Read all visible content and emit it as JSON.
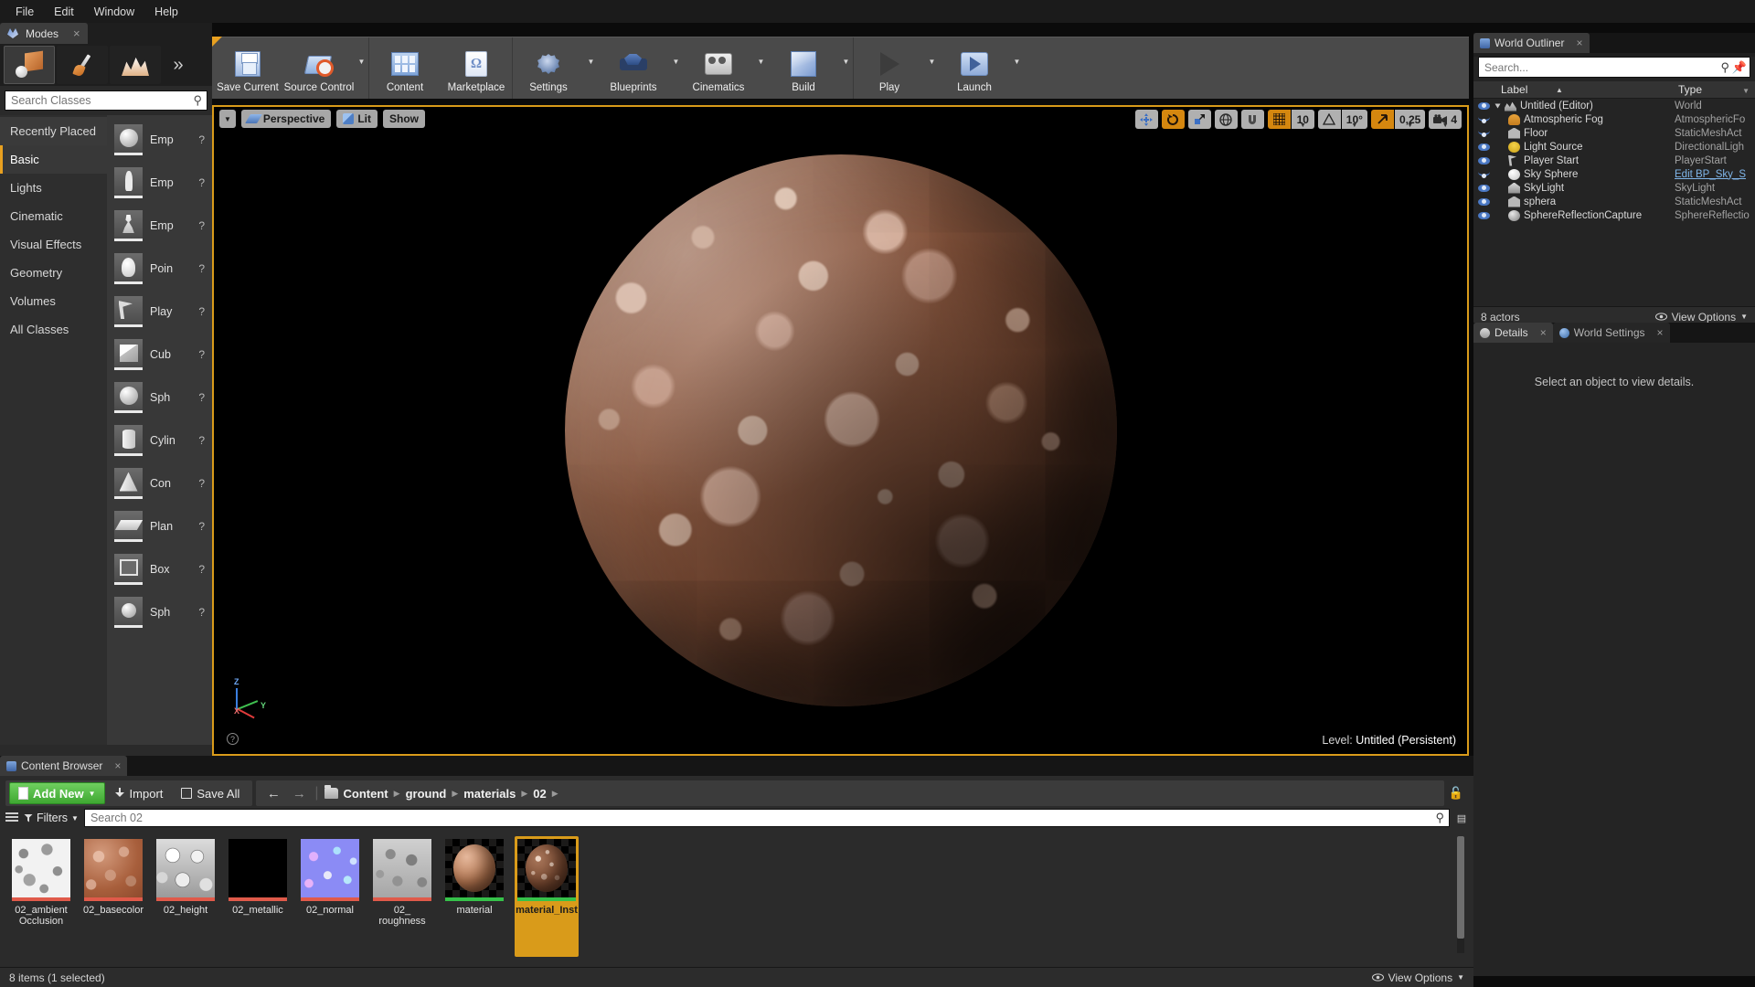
{
  "menu": {
    "items": [
      "File",
      "Edit",
      "Window",
      "Help"
    ]
  },
  "modes_panel": {
    "tab_label": "Modes",
    "tab_icon": "unreal-modes-icon",
    "mode_buttons": [
      {
        "name": "place-mode",
        "icon": "place-cube-icon",
        "active": true
      },
      {
        "name": "paint-mode",
        "icon": "paint-brush-icon",
        "active": false
      },
      {
        "name": "landscape-mode",
        "icon": "landscape-mountains-icon",
        "active": false
      },
      {
        "name": "expand-modes",
        "icon": "chevron-double-right-icon",
        "active": false
      }
    ],
    "search": {
      "placeholder": "Search Classes",
      "value": ""
    },
    "categories": [
      {
        "label": "Recently Placed",
        "selected": false,
        "hovered": true
      },
      {
        "label": "Basic",
        "selected": true,
        "hovered": false
      },
      {
        "label": "Lights",
        "selected": false,
        "hovered": false
      },
      {
        "label": "Cinematic",
        "selected": false,
        "hovered": false
      },
      {
        "label": "Visual Effects",
        "selected": false,
        "hovered": false
      },
      {
        "label": "Geometry",
        "selected": false,
        "hovered": false
      },
      {
        "label": "Volumes",
        "selected": false,
        "hovered": false
      },
      {
        "label": "All Classes",
        "selected": false,
        "hovered": false
      }
    ],
    "placeables": [
      {
        "label": "Emp",
        "thumb": "sphere-thumb",
        "help": "?"
      },
      {
        "label": "Emp",
        "thumb": "human-thumb",
        "help": "?"
      },
      {
        "label": "Emp",
        "thumb": "pawn-thumb",
        "help": "?"
      },
      {
        "label": "Poin",
        "thumb": "bulb-thumb",
        "help": "?"
      },
      {
        "label": "Play",
        "thumb": "flag-thumb",
        "help": "?"
      },
      {
        "label": "Cub",
        "thumb": "cube-thumb",
        "help": "?"
      },
      {
        "label": "Sph",
        "thumb": "sphere-thumb",
        "help": "?"
      },
      {
        "label": "Cylin",
        "thumb": "cylinder-thumb",
        "help": "?"
      },
      {
        "label": "Con",
        "thumb": "cone-thumb",
        "help": "?"
      },
      {
        "label": "Plan",
        "thumb": "plane-thumb",
        "help": "?"
      },
      {
        "label": "Box",
        "thumb": "box-thumb",
        "help": "?"
      },
      {
        "label": "Sph",
        "thumb": "sphere-thumb",
        "help": "?"
      }
    ]
  },
  "toolbar": {
    "groups": [
      {
        "items": [
          {
            "label": "Save Current",
            "icon": "save-icon",
            "dropdown": false
          },
          {
            "label": "Source Control",
            "icon": "source-control-icon",
            "dropdown": true
          }
        ]
      },
      {
        "items": [
          {
            "label": "Content",
            "icon": "content-icon",
            "dropdown": false
          },
          {
            "label": "Marketplace",
            "icon": "marketplace-icon",
            "dropdown": false
          }
        ]
      },
      {
        "items": [
          {
            "label": "Settings",
            "icon": "settings-gear-icon",
            "dropdown": true
          },
          {
            "label": "Blueprints",
            "icon": "blueprints-icon",
            "dropdown": true
          },
          {
            "label": "Cinematics",
            "icon": "cinematics-icon",
            "dropdown": true
          },
          {
            "label": "Build",
            "icon": "build-icon",
            "dropdown": true
          }
        ]
      },
      {
        "items": [
          {
            "label": "Play",
            "icon": "play-icon",
            "dropdown": true
          },
          {
            "label": "Launch",
            "icon": "launch-icon",
            "dropdown": true
          }
        ]
      }
    ]
  },
  "viewport": {
    "left_controls": [
      {
        "name": "viewport-options",
        "label": "",
        "icon": "chevron-down-icon"
      },
      {
        "name": "view-perspective",
        "label": "Perspective",
        "icon": "perspective-icon"
      },
      {
        "name": "view-mode-lit",
        "label": "Lit",
        "icon": "lit-cube-icon"
      },
      {
        "name": "show-menu",
        "label": "Show",
        "icon": ""
      }
    ],
    "transform_tools": [
      {
        "name": "translate-mode",
        "icon": "move-arrows-icon",
        "active": false
      },
      {
        "name": "rotate-mode",
        "icon": "rotate-icon",
        "active": true
      },
      {
        "name": "scale-mode",
        "icon": "scale-icon",
        "active": false
      }
    ],
    "coordinate_system": {
      "name": "world-space-toggle",
      "icon": "globe-icon"
    },
    "surface_snap": {
      "name": "surface-snap-toggle",
      "icon": "magnet-icon",
      "active": false
    },
    "grid_snap": {
      "name": "grid-snap-toggle",
      "icon": "grid-icon",
      "active": true,
      "value": "10"
    },
    "angle_snap": {
      "name": "angle-snap-toggle",
      "icon": "angle-icon",
      "active": false,
      "value": "10°"
    },
    "scale_snap": {
      "name": "scale-snap-toggle",
      "icon": "scale-arrow-icon",
      "active": true,
      "value": "0,25"
    },
    "camera_speed": {
      "name": "camera-speed",
      "icon": "camera-icon",
      "value": "4"
    },
    "level_label": "Level:",
    "level_name": "Untitled (Persistent)",
    "gizmo_axes": [
      "Z",
      "Y",
      "X"
    ]
  },
  "outliner": {
    "tab_label": "World Outliner",
    "search": {
      "placeholder": "Search...",
      "value": ""
    },
    "columns": {
      "label": "Label",
      "type": "Type"
    },
    "rows": [
      {
        "label": "Untitled (Editor)",
        "type": "World",
        "visible": true,
        "icon": "world-icon",
        "depth": 0,
        "expander": true
      },
      {
        "label": "Atmospheric Fog",
        "type": "AtmosphericFo",
        "visible": false,
        "icon": "fog-icon",
        "depth": 1
      },
      {
        "label": "Floor",
        "type": "StaticMeshAct",
        "visible": false,
        "icon": "mesh-icon",
        "depth": 1
      },
      {
        "label": "Light Source",
        "type": "DirectionalLigh",
        "visible": true,
        "icon": "light-icon",
        "depth": 1
      },
      {
        "label": "Player Start",
        "type": "PlayerStart",
        "visible": true,
        "icon": "player-start-icon",
        "depth": 1
      },
      {
        "label": "Sky Sphere",
        "type": "Edit BP_Sky_S",
        "visible": false,
        "icon": "sky-icon",
        "depth": 1,
        "type_is_link": true
      },
      {
        "label": "SkyLight",
        "type": "SkyLight",
        "visible": true,
        "icon": "skylight-icon",
        "depth": 1
      },
      {
        "label": "sphera",
        "type": "StaticMeshAct",
        "visible": true,
        "icon": "mesh-icon",
        "depth": 1
      },
      {
        "label": "SphereReflectionCapture",
        "type": "SphereReflectio",
        "visible": true,
        "icon": "reflection-icon",
        "depth": 1
      }
    ],
    "footer_count": "8 actors",
    "view_options": "View Options"
  },
  "details": {
    "tabs": [
      {
        "label": "Details",
        "icon": "details-icon",
        "active": true
      },
      {
        "label": "World Settings",
        "icon": "world-settings-icon",
        "active": false
      }
    ],
    "empty_message": "Select an object to view details."
  },
  "content_browser": {
    "tab_label": "Content Browser",
    "add_new": "Add New",
    "import": "Import",
    "save_all": "Save All",
    "breadcrumbs": [
      "Content",
      "ground",
      "materials",
      "02"
    ],
    "filters_label": "Filters",
    "search": {
      "placeholder": "Search 02",
      "value": ""
    },
    "assets": [
      {
        "name": "02_ambient Occlusion",
        "thumb": "ao-texture",
        "bar_color": "#e05a4a",
        "selected": false
      },
      {
        "name": "02_basecolor",
        "thumb": "basecolor-texture",
        "bar_color": "#e05a4a",
        "selected": false
      },
      {
        "name": "02_height",
        "thumb": "height-texture",
        "bar_color": "#e05a4a",
        "selected": false
      },
      {
        "name": "02_metallic",
        "thumb": "metallic-texture",
        "bar_color": "#e05a4a",
        "selected": false
      },
      {
        "name": "02_normal",
        "thumb": "normal-texture",
        "bar_color": "#e05a4a",
        "selected": false
      },
      {
        "name": "02_ roughness",
        "thumb": "roughness-texture",
        "bar_color": "#e05a4a",
        "selected": false
      },
      {
        "name": "material",
        "thumb": "material-sphere",
        "bar_color": "#36c24a",
        "selected": false
      },
      {
        "name": "material_Inst",
        "thumb": "material-instance-sphere",
        "bar_color": "#36c24a",
        "selected": true
      }
    ],
    "footer_status": "8 items (1 selected)",
    "view_options": "View Options"
  },
  "colors": {
    "accent_orange": "#d99b1a",
    "add_new_green": "#3fa832",
    "selection_yellow": "#f0a91e",
    "link_blue": "#7fb5e8"
  }
}
